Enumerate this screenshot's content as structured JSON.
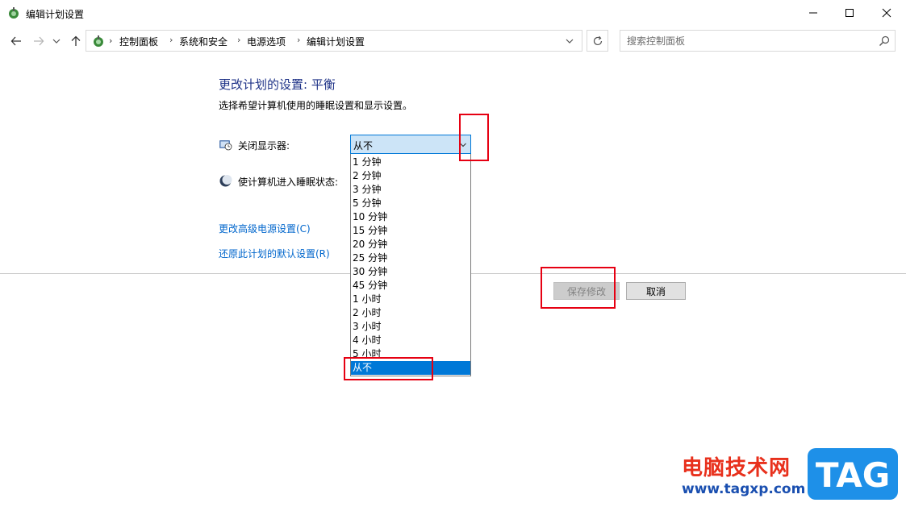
{
  "window": {
    "title": "编辑计划设置"
  },
  "address_bar": {
    "crumbs": [
      "控制面板",
      "系统和安全",
      "电源选项",
      "编辑计划设置"
    ]
  },
  "search": {
    "placeholder": "搜索控制面板"
  },
  "content": {
    "title": "更改计划的设置: 平衡",
    "subtitle": "选择希望计算机使用的睡眠设置和显示设置。",
    "display_off_label": "关闭显示器:",
    "sleep_label": "使计算机进入睡眠状态:",
    "advanced_link": "更改高级电源设置(C)",
    "restore_link": "还原此计划的默认设置(R)"
  },
  "combo": {
    "value": "从不",
    "options": [
      "1 分钟",
      "2 分钟",
      "3 分钟",
      "5 分钟",
      "10 分钟",
      "15 分钟",
      "20 分钟",
      "25 分钟",
      "30 分钟",
      "45 分钟",
      "1 小时",
      "2 小时",
      "3 小时",
      "4 小时",
      "5 小时",
      "从不"
    ],
    "selected": "从不"
  },
  "buttons": {
    "save": "保存修改",
    "cancel": "取消"
  },
  "watermark": {
    "text": "电脑技术网",
    "url": "www.tagxp.com",
    "logo": "TAG"
  },
  "colors": {
    "accent": "#0078d7",
    "title_blue": "#1e3287",
    "link": "#0066cc",
    "highlight_red": "#e60012"
  }
}
